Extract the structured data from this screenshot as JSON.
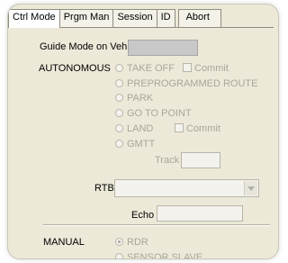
{
  "tabs": [
    "Ctrl Mode",
    "Prgm Man",
    "Session",
    "ID",
    "Abort"
  ],
  "guide_mode": {
    "label": "Guide Mode on Veh",
    "value": ""
  },
  "autonomous": {
    "label": "AUTONOMOUS",
    "options": [
      "TAKE OFF",
      "PREPROGRAMMED ROUTE",
      "PARK",
      "GO TO POINT",
      "LAND",
      "GMTT"
    ],
    "takeoff_commit": "Commit",
    "land_commit": "Commit",
    "track_label": "Track",
    "track_value": ""
  },
  "rtb": {
    "label": "RTB",
    "value": ""
  },
  "echo": {
    "label": "Echo",
    "value": ""
  },
  "manual": {
    "label": "MANUAL",
    "options": [
      "RDR",
      "SENSOR SLAVE"
    ],
    "selected": "RDR"
  },
  "colors": {
    "panel_bg": "#ece9d8",
    "disabled_text": "#a8a69c",
    "guide_field": "#c8c8c8"
  }
}
